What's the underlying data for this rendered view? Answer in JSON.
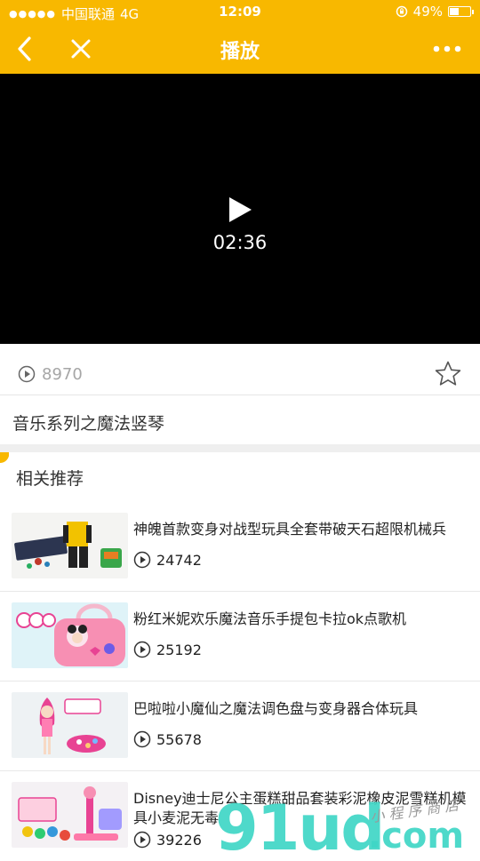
{
  "status_bar": {
    "signal_dots": "●●●●●",
    "carrier": "中国联通",
    "network": "4G",
    "time": "12:09",
    "battery_percent": "49%",
    "battery_level": 0.49
  },
  "nav": {
    "title": "播放",
    "back_icon": "chevron-left-icon",
    "close_icon": "close-icon",
    "more_icon": "more-dots-icon"
  },
  "video": {
    "duration": "02:36",
    "play_icon": "play-icon"
  },
  "stats": {
    "play_count": "8970",
    "favorite_icon": "star-outline-icon"
  },
  "video_title": "音乐系列之魔法竖琴",
  "related": {
    "heading": "相关推荐",
    "items": [
      {
        "title": "神魄首款变身对战型玩具全套带破天石超限机械兵",
        "plays": "24742"
      },
      {
        "title": "粉红米妮欢乐魔法音乐手提包卡拉ok点歌机",
        "plays": "25192"
      },
      {
        "title": "巴啦啦小魔仙之魔法调色盘与变身器合体玩具",
        "plays": "55678"
      },
      {
        "title": "Disney迪士尼公主蛋糕甜品套装彩泥橡皮泥雪糕机模具小麦泥无毒",
        "plays": "39226"
      }
    ]
  },
  "watermark": {
    "main": "91ud",
    "suffix": ".com",
    "handwriting": "小程序商店"
  },
  "colors": {
    "brand": "#f8b800",
    "video_bg": "#000000",
    "watermark": "#3fd6c5"
  }
}
